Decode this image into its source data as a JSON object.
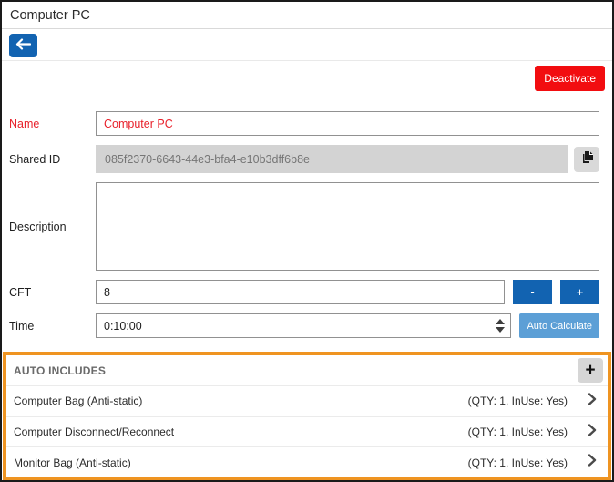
{
  "window": {
    "title": "Computer PC"
  },
  "colors": {
    "primary_blue": "#1263b1",
    "light_blue": "#5c9fd6",
    "deactivate_red": "#f20d10",
    "field_red": "#e8212b",
    "highlight_orange": "#ef9421"
  },
  "toolbar": {
    "deactivate_label": "Deactivate"
  },
  "form": {
    "name": {
      "label": "Name",
      "value": "Computer PC"
    },
    "shared_id": {
      "label": "Shared ID",
      "value": "085f2370-6643-44e3-bfa4-e10b3dff6b8e"
    },
    "description": {
      "label": "Description",
      "value": ""
    },
    "cft": {
      "label": "CFT",
      "value": "8",
      "minus_label": "-",
      "plus_label": "+"
    },
    "time": {
      "label": "Time",
      "value": "0:10:00",
      "auto_calculate_label": "Auto Calculate"
    }
  },
  "auto_includes": {
    "title": "AUTO INCLUDES",
    "add_label": "+",
    "items": [
      {
        "name": "Computer Bag (Anti-static)",
        "detail": "(QTY: 1, InUse: Yes)"
      },
      {
        "name": "Computer Disconnect/Reconnect",
        "detail": "(QTY: 1, InUse: Yes)"
      },
      {
        "name": "Monitor Bag (Anti-static)",
        "detail": "(QTY: 1, InUse: Yes)"
      }
    ]
  }
}
